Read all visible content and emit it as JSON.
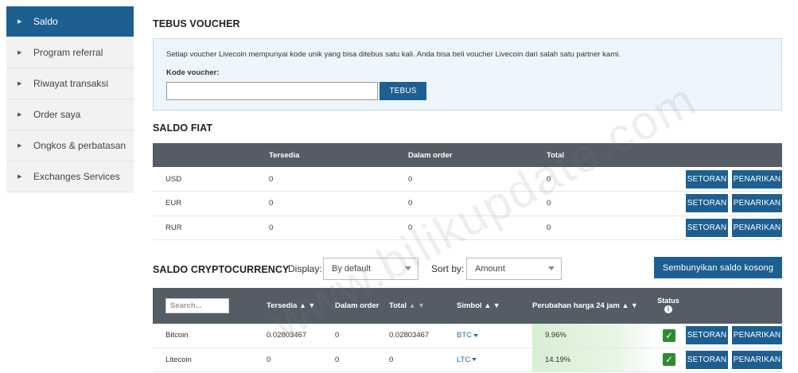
{
  "sidebar": {
    "items": [
      {
        "label": "Saldo"
      },
      {
        "label": "Program referral"
      },
      {
        "label": "Riwayat transaksi"
      },
      {
        "label": "Order saya"
      },
      {
        "label": "Ongkos & perbatasan"
      },
      {
        "label": "Exchanges Services"
      }
    ]
  },
  "voucher": {
    "title": "TEBUS VOUCHER",
    "description": "Setiap voucher Livecoin mempunyai kode unik yang bisa ditebus satu kali. Anda bisa beli voucher Livecoin dari salah satu partner kami.",
    "code_label": "Kode voucher:",
    "code_value": "",
    "button": "TEBUS"
  },
  "fiat": {
    "title": "SALDO FIAT",
    "columns": [
      "",
      "Tersedia",
      "Dalam order",
      "Total"
    ],
    "deposit_label": "SETORAN",
    "withdraw_label": "PENARIKAN",
    "rows": [
      {
        "currency": "USD",
        "available": "0",
        "in_order": "0",
        "total": "0"
      },
      {
        "currency": "EUR",
        "available": "0",
        "in_order": "0",
        "total": "0"
      },
      {
        "currency": "RUR",
        "available": "0",
        "in_order": "0",
        "total": "0"
      }
    ]
  },
  "crypto": {
    "title": "SALDO CRYPTOCURRENCY",
    "display_label": "Display:",
    "display_value": "By default",
    "sort_label": "Sort by:",
    "sort_value": "Amount",
    "hide_button": "Sembunyikan saldo kosong",
    "search_placeholder": "Search...",
    "columns": {
      "available": "Tersedia",
      "in_order": "Dalam order",
      "total": "Total",
      "symbol": "Simbol",
      "change": "Perubahan harga 24 jam",
      "status": "Status"
    },
    "sort_arrows": "▲ ▼",
    "deposit_label": "SETORAN",
    "withdraw_label": "PENARIKAN",
    "rows": [
      {
        "name": "Bitcoin",
        "available": "0.02803467",
        "in_order": "0",
        "total": "0.02803467",
        "symbol": "BTC",
        "change": "9.96%"
      },
      {
        "name": "Litecoin",
        "available": "0",
        "in_order": "0",
        "total": "0",
        "symbol": "LTC",
        "change": "14.19%"
      }
    ]
  },
  "watermark": "www.bilikupdate.com",
  "colors": {
    "accent": "#1e5f91",
    "header": "#545d66",
    "status_ok": "#2e8b2e"
  }
}
